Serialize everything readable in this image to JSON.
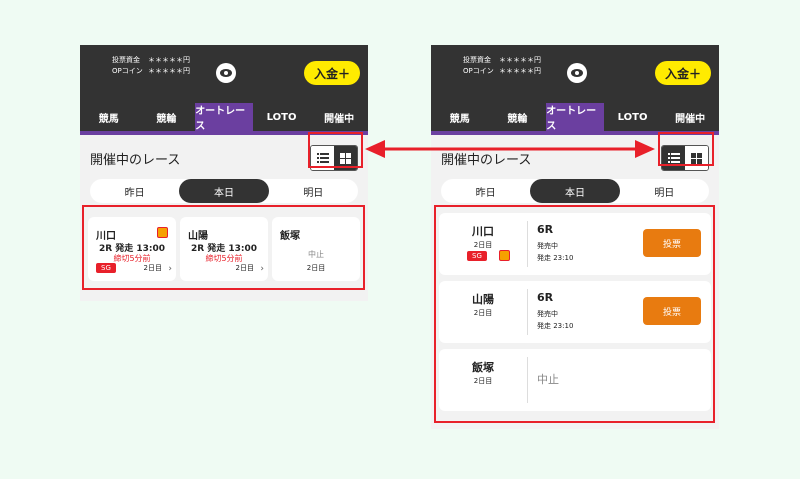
{
  "balance": {
    "label1": "投票資金",
    "value1": "＊＊＊＊＊円",
    "label2": "OPコイン",
    "value2": "＊＊＊＊＊円"
  },
  "deposit_label": "入金＋",
  "nav_tabs": [
    {
      "label": "競馬"
    },
    {
      "label": "競輪"
    },
    {
      "label": "オートレース"
    },
    {
      "label": "LOTO"
    },
    {
      "label": "開催中"
    }
  ],
  "section_title": "開催中のレース",
  "day_tabs": [
    "昨日",
    "本日",
    "明日"
  ],
  "races": [
    {
      "venue": "川口",
      "race": "2R 発走 13:00",
      "close": "締切5分前",
      "grade": "SG",
      "day": "2日目",
      "round": "6R",
      "status": "発売中",
      "start": "発走 23:10",
      "bet": "投票"
    },
    {
      "venue": "山陽",
      "race": "2R 発走 13:00",
      "close": "締切5分前",
      "day": "2日目",
      "round": "6R",
      "status": "発売中",
      "start": "発走 23:10",
      "bet": "投票"
    },
    {
      "venue": "飯塚",
      "cancel": "中止",
      "day": "2日目"
    }
  ],
  "colors": {
    "accent": "#6b3fa0",
    "highlight": "#e8202a",
    "bet": "#e87b10",
    "deposit": "#ffeb00"
  }
}
